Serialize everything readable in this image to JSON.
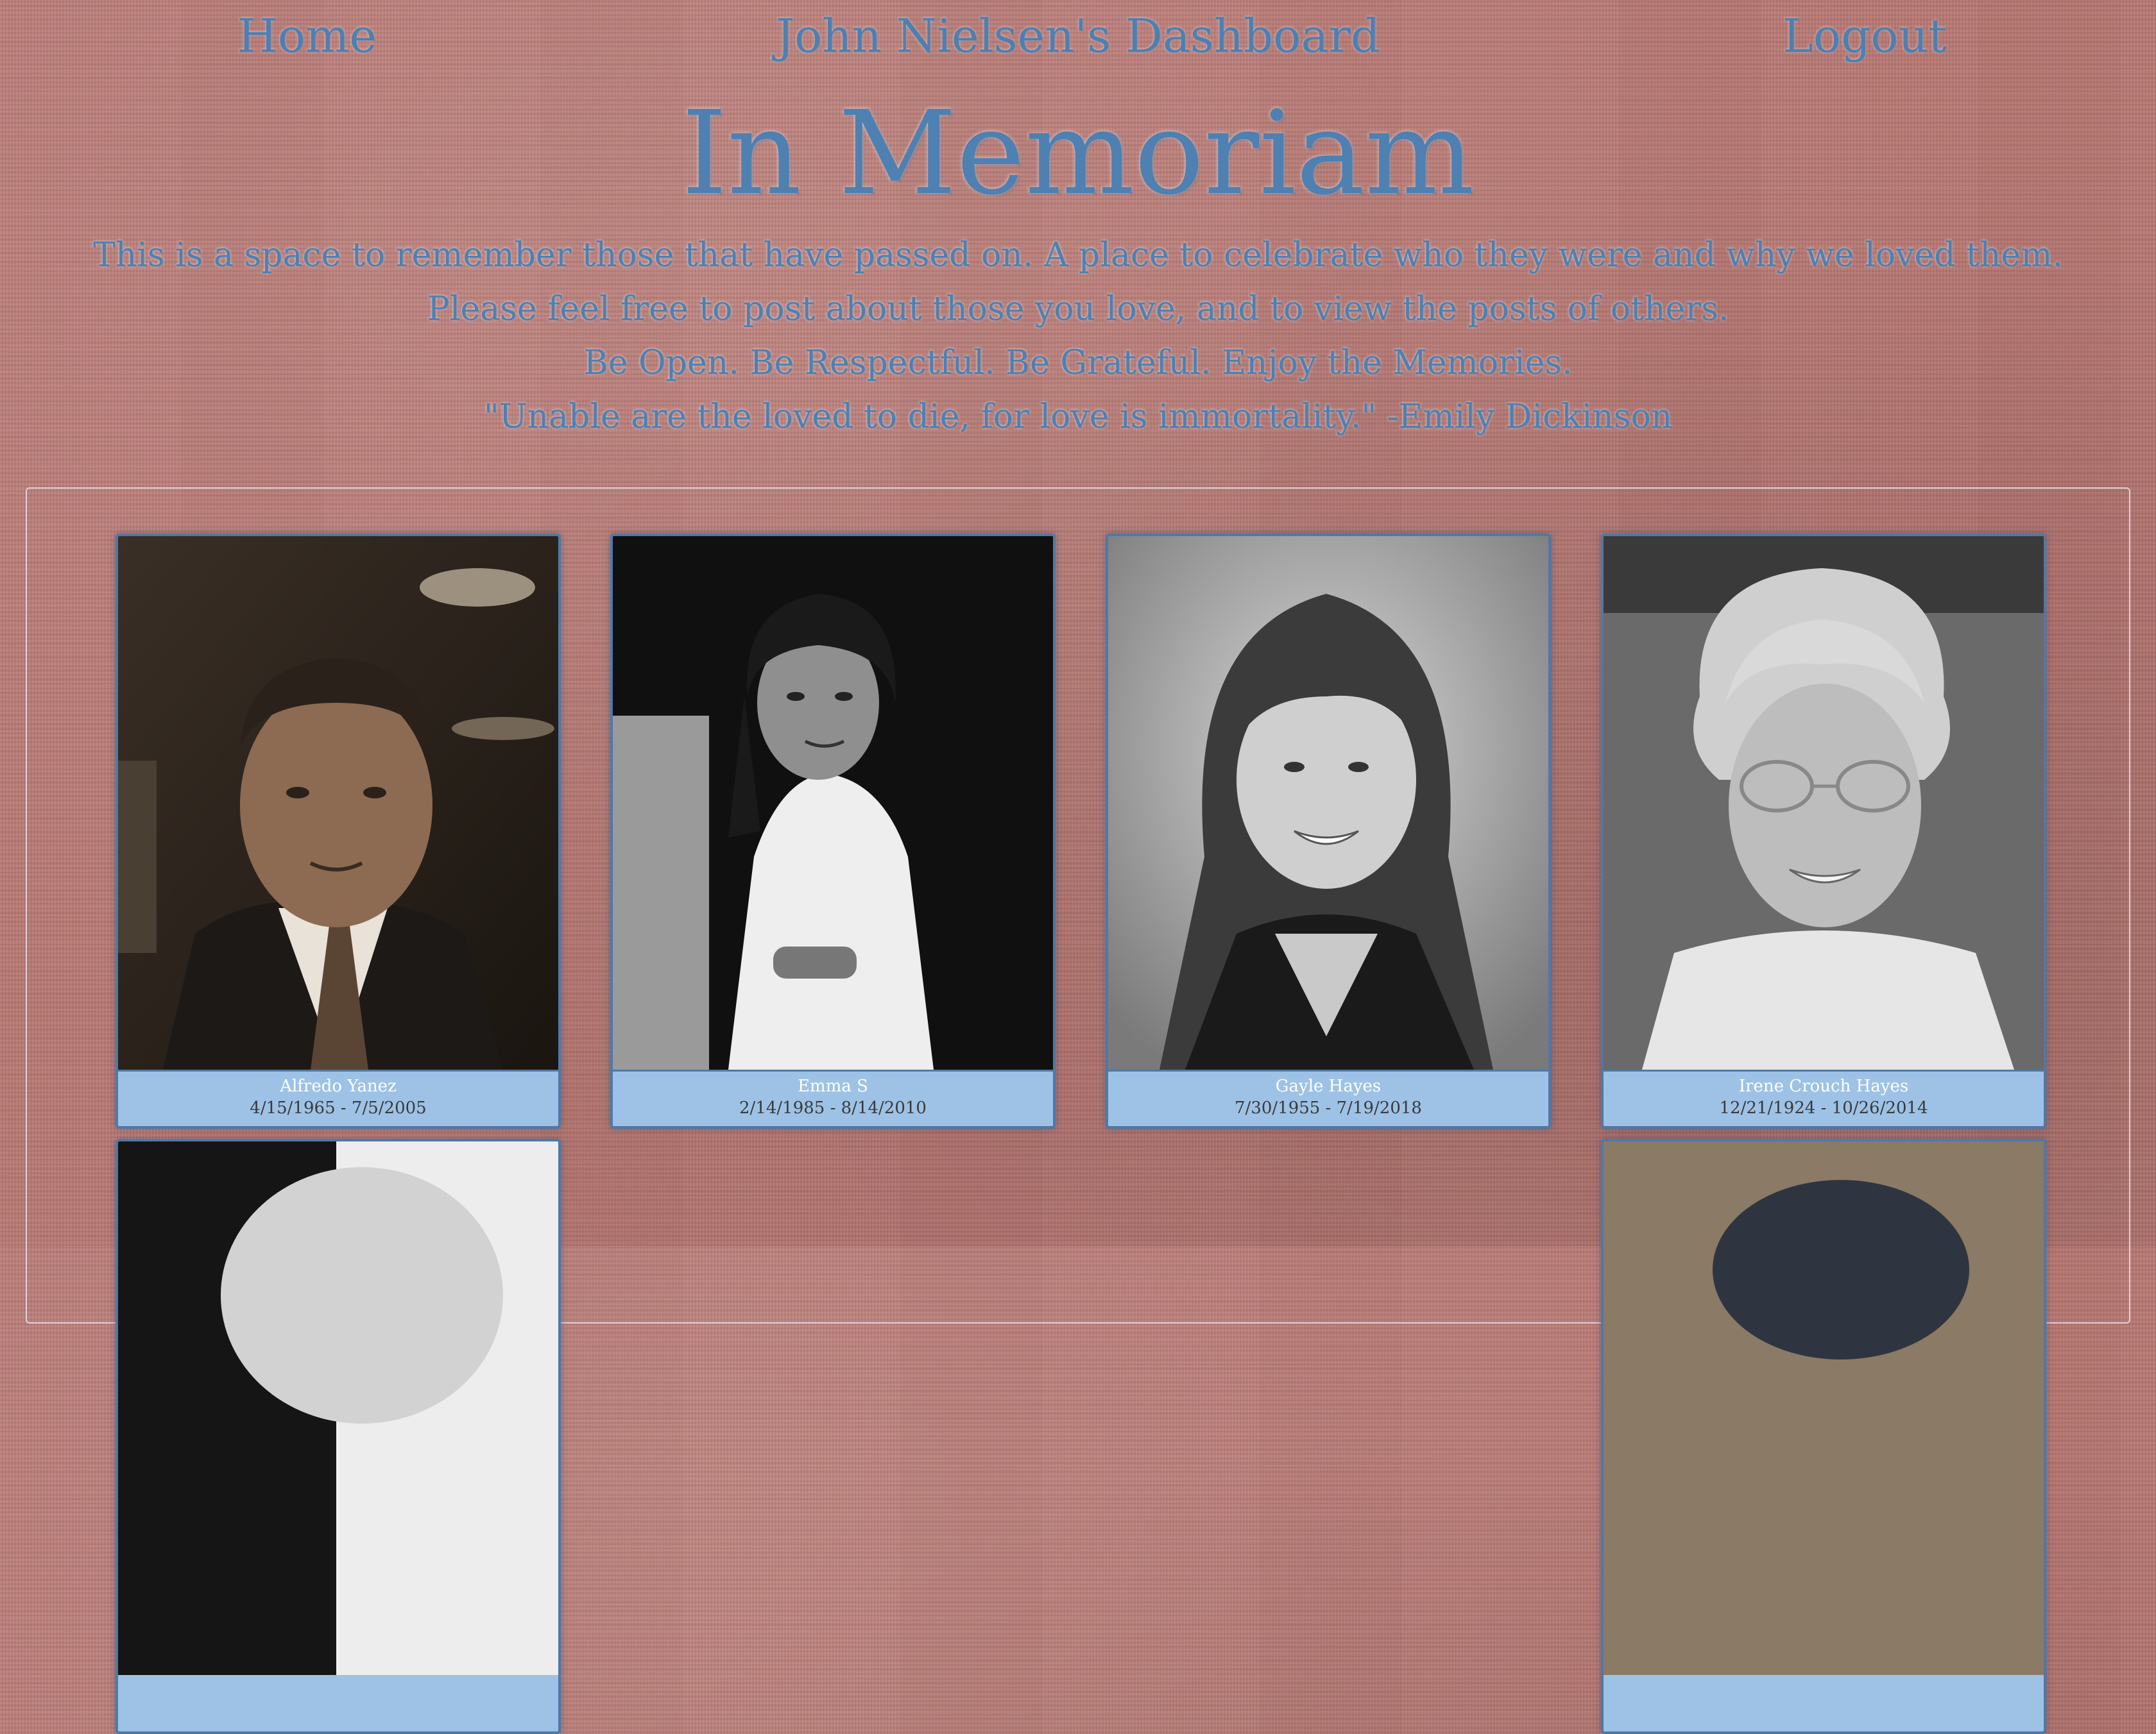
{
  "nav": {
    "home_label": "Home",
    "title": "John Nielsen's Dashboard",
    "logout_label": "Logout"
  },
  "hero": {
    "title": "In Memoriam",
    "lines": [
      "This is a space to remember those that have passed on. A place to celebrate who they were and why we loved them.",
      "Please feel free to post about those you love, and to view the posts of others.",
      "Be Open. Be Respectful. Be Grateful. Enjoy the Memories.",
      "\"Unable are the loved to die, for love is immortality.\" -Emily Dickinson"
    ]
  },
  "memorials": [
    {
      "name": "Alfredo Yanez",
      "dates": "4/15/1965 - 7/5/2005"
    },
    {
      "name": "Emma S",
      "dates": "2/14/1985 - 8/14/2010"
    },
    {
      "name": "Gayle Hayes",
      "dates": "7/30/1955 - 7/19/2018"
    },
    {
      "name": "Irene Crouch Hayes",
      "dates": "12/21/1924 - 10/26/2014"
    }
  ],
  "theme": {
    "background": "#b97873",
    "text_blue": "#4e80b2",
    "caption_bg": "#9dc2e6",
    "card_border": "#4f79a6"
  }
}
